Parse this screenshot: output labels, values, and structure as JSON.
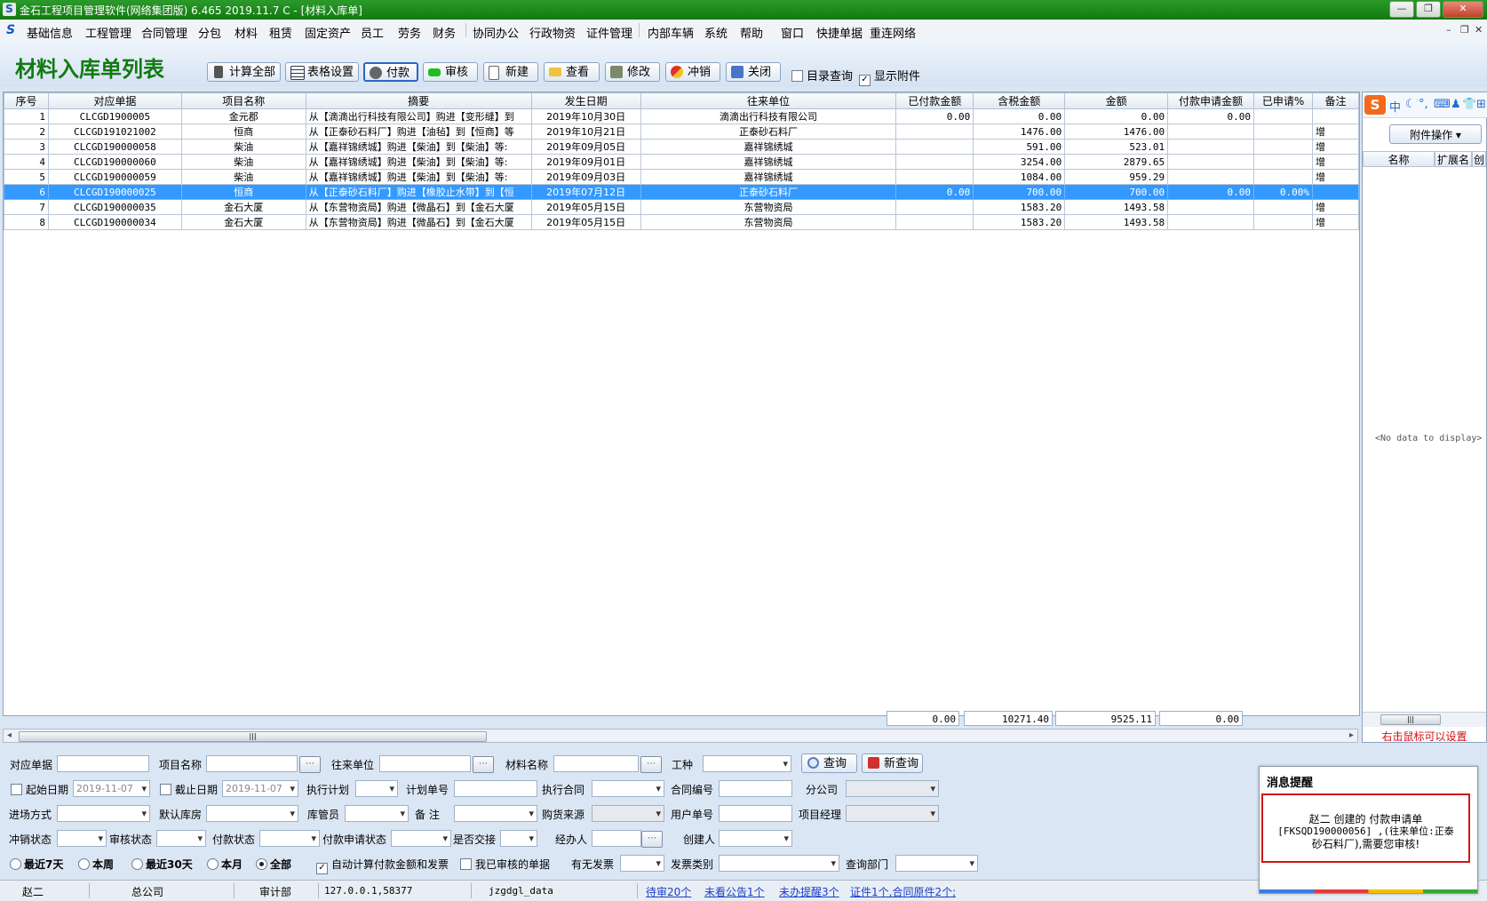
{
  "window": {
    "title": "金石工程项目管理软件(网络集团版) 6.465  2019.11.7 C - [材料入库单]",
    "min": "—",
    "max": "❐",
    "close": "✕"
  },
  "menu": [
    "基础信息",
    "工程管理",
    "合同管理",
    "分包",
    "材料",
    "租赁",
    "固定资产",
    "员工",
    "劳务",
    "财务",
    "协同办公",
    "行政物资",
    "证件管理",
    "内部车辆",
    "系统",
    "帮助",
    "窗口",
    "快捷单据",
    "重连网络"
  ],
  "mdi_controls": {
    "min": "–",
    "restore": "❐",
    "close": "✕"
  },
  "page": {
    "title": "材料入库单列表"
  },
  "toolbar": {
    "buttons": [
      "计算全部",
      "表格设置",
      "付款",
      "审核",
      "新建",
      "查看",
      "修改",
      "冲销",
      "关闭"
    ],
    "checks": [
      {
        "label": "目录查询",
        "checked": false
      },
      {
        "label": "显示附件",
        "checked": true
      }
    ]
  },
  "grid": {
    "columns": [
      "序号",
      "对应单据",
      "项目名称",
      "摘要",
      "发生日期",
      "往来单位",
      "已付款金额",
      "含税金额",
      "金额",
      "付款申请金额",
      "已申请%",
      "备注"
    ],
    "rows": [
      [
        "1",
        "CLCGD1900005",
        "金元郡",
        "从【滴滴出行科技有限公司】购进【变形缝】到",
        "2019年10月30日",
        "滴滴出行科技有限公司",
        "0.00",
        "0.00",
        "0.00",
        "0.00",
        "",
        ""
      ],
      [
        "2",
        "CLCGD191021002",
        "恒商",
        "从【正泰砂石料厂】购进【油毡】到【恒商】等",
        "2019年10月21日",
        "正泰砂石料厂",
        "",
        "1476.00",
        "1476.00",
        "",
        "",
        "增"
      ],
      [
        "3",
        "CLCGD190000058",
        "柴油",
        "从【嘉祥锦绣城】购进【柴油】到【柴油】等:",
        "2019年09月05日",
        "嘉祥锦绣城",
        "",
        "591.00",
        "523.01",
        "",
        "",
        "增"
      ],
      [
        "4",
        "CLCGD190000060",
        "柴油",
        "从【嘉祥锦绣城】购进【柴油】到【柴油】等:",
        "2019年09月01日",
        "嘉祥锦绣城",
        "",
        "3254.00",
        "2879.65",
        "",
        "",
        "增"
      ],
      [
        "5",
        "CLCGD190000059",
        "柴油",
        "从【嘉祥锦绣城】购进【柴油】到【柴油】等:",
        "2019年09月03日",
        "嘉祥锦绣城",
        "",
        "1084.00",
        "959.29",
        "",
        "",
        "增"
      ],
      [
        "6",
        "CLCGD190000025",
        "恒商",
        "从【正泰砂石料厂】购进【橡胶止水带】到【恒",
        "2019年07月12日",
        "正泰砂石料厂",
        "0.00",
        "700.00",
        "700.00",
        "0.00",
        "0.00%",
        ""
      ],
      [
        "7",
        "CLCGD190000035",
        "金石大厦",
        "从【东营物资局】购进【微晶石】到【金石大厦",
        "2019年05月15日",
        "东营物资局",
        "",
        "1583.20",
        "1493.58",
        "",
        "",
        "增"
      ],
      [
        "8",
        "CLCGD190000034",
        "金石大厦",
        "从【东营物资局】购进【微晶石】到【金石大厦",
        "2019年05月15日",
        "东营物资局",
        "",
        "1583.20",
        "1493.58",
        "",
        "",
        "增"
      ]
    ],
    "selected_row": 6,
    "totals": {
      "paid": "0.00",
      "tax_amount": "10271.40",
      "amount": "9525.11",
      "pay_request": "0.00"
    }
  },
  "attachments": {
    "ime": {
      "logo": "S",
      "lang": "中",
      "moon": "☾",
      "punct": "°,",
      "kbd": "⌨",
      "user": "♟",
      "shirt": "👕",
      "grid": "⊞"
    },
    "button": "附件操作",
    "columns": [
      "名称",
      "扩展名",
      "创"
    ],
    "empty": "<No data to display>",
    "hint": "右击鼠标可以设置"
  },
  "query": {
    "labels": {
      "doc": "对应单据",
      "project": "项目名称",
      "partner": "往来单位",
      "material": "材料名称",
      "trade": "工种",
      "start": "起始日期",
      "end": "截止日期",
      "plan": "执行计划",
      "plan_no": "计划单号",
      "contract": "执行合同",
      "contract_no": "合同编号",
      "branch": "分公司",
      "entry": "进场方式",
      "warehouse": "默认库房",
      "keeper": "库管员",
      "remark": "备  注",
      "source": "购货来源",
      "user_no": "用户单号",
      "manager": "项目经理",
      "writeoff": "冲销状态",
      "audit": "审核状态",
      "pay": "付款状态",
      "pay_req": "付款申请状态",
      "handover": "是否交接",
      "handler": "经办人",
      "creator": "创建人",
      "invoice": "有无发票",
      "invoice_type": "发票类别",
      "dept": "查询部门"
    },
    "start_date": "2019-11-07",
    "end_date": "2019-11-07",
    "buttons": {
      "search": "查询",
      "new_search": "新查询"
    },
    "ranges": [
      {
        "label": "最近7天",
        "on": false
      },
      {
        "label": "本周",
        "on": false
      },
      {
        "label": "最近30天",
        "on": false
      },
      {
        "label": "本月",
        "on": false
      },
      {
        "label": "全部",
        "on": true
      }
    ],
    "auto_calc": "自动计算付款金额和发票",
    "mine": "我已审核的单据"
  },
  "status": {
    "user": "赵二",
    "company": "总公司",
    "dept": "审计部",
    "addr": "127.0.0.1,58377",
    "db": "jzgdgl_data",
    "todo": "待审20个",
    "notice": "未看公告1个",
    "remind": "未办提醒3个",
    "cert": "证件1个,合同原件2个;"
  },
  "message": {
    "title": "消息提醒",
    "line1": "赵二 创建的 付款申请单",
    "line2": "[FKSQD190000056] ,(往来单位:正泰",
    "line3": "砂石料厂),需要您审核!"
  }
}
